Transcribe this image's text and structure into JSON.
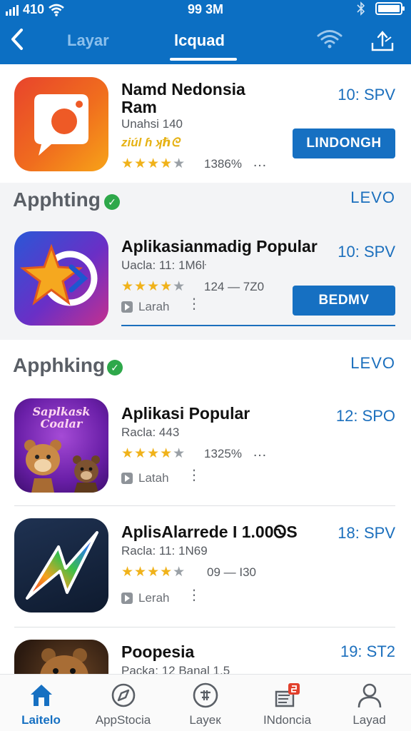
{
  "status_bar": {
    "network": "410",
    "time": "99 3M"
  },
  "nav": {
    "tab_inactive": "Layar",
    "tab_active": "lcquad"
  },
  "apps": [
    {
      "name_line1": "Namd Nedonsia",
      "name_line2": "Ram",
      "sub": "Unahsi  140",
      "extra": "ziúl ɦ ʞℏᘓ",
      "rating_text": "1386%",
      "time": "10: SPV",
      "button": "LINDONGH"
    },
    {
      "name": "Aplikasianmadig Popular",
      "sub": "Uacla: 11: 1M6ŀ",
      "rating_text": "124 — 7Z0",
      "meta": "Larah",
      "time": "10: SPV",
      "button": "BEDMV"
    },
    {
      "name": "Aplikasi Popular",
      "sub": "Racla: 443",
      "rating_text": "1325%",
      "meta": "Latah",
      "time": "12: SPO",
      "icon_text_1": "Saplkask",
      "icon_text_2": "Coalar"
    },
    {
      "name": "AplisAlarrede I 1.00ᏫS",
      "sub": "Racla: 11: 1N69",
      "rating_text": "09 — I30",
      "meta": "Lerah",
      "time": "18: SPV"
    },
    {
      "name": "Poopesia",
      "sub": "Packa: 12 Banal  1.5",
      "time": "19: ST2"
    }
  ],
  "sections": [
    {
      "title": "Apphting",
      "action": "LEVO"
    },
    {
      "title": "Apphking",
      "action": "LEVO"
    }
  ],
  "bottom_nav": [
    "Laitelo",
    "AppStocia",
    "Layeк",
    "INdoncia",
    "Layad"
  ],
  "colors": {
    "primary": "#0c6fc3",
    "accent": "#1670c2",
    "star": "#f0b21a",
    "verified": "#2ea84a"
  }
}
